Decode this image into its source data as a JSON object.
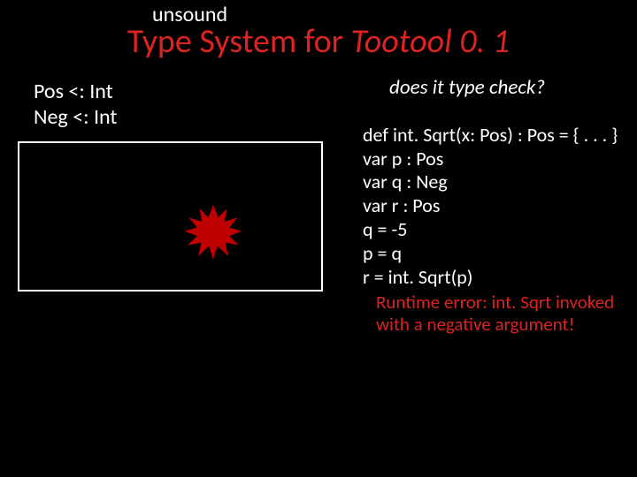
{
  "unsound": "unsound",
  "title_pre": "Type System for ",
  "title_italic": "Tootool 0. 1",
  "subtypes_l1": "Pos <: Int",
  "subtypes_l2": "Neg <: Int",
  "question": "does it type check?",
  "code_l1": "def int. Sqrt(x: Pos) : Pos = { . . . }",
  "code_l2": "var p : Pos",
  "code_l3": "var q : Neg",
  "code_l4": "var r : Pos",
  "code_l5": "q = -5",
  "code_l6": "p = q",
  "code_l7": "r = int. Sqrt(p)",
  "error_l1": "Runtime error: int. Sqrt invoked",
  "error_l2": "with a negative argument!"
}
